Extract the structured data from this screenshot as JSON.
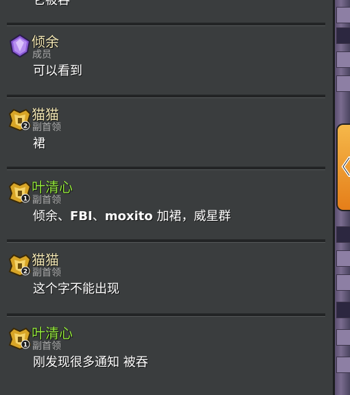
{
  "top_partial_text": "它被吞",
  "messages": [
    {
      "name": "倾余",
      "role": "成员",
      "text": "可以看到",
      "badge": "purple-league-badge-icon",
      "name_color": "#f1e6b4"
    },
    {
      "name": "猫猫",
      "role": "副首领",
      "text": "裙",
      "badge": "gold-titan-badge-2-icon",
      "badge_number": "2",
      "name_color": "#f1e6b4"
    },
    {
      "name": "叶清心",
      "role": "副首领",
      "text_parts": [
        "倾余、",
        "FBI",
        "、",
        "moxito",
        " 加裙，威星群"
      ],
      "badge": "gold-titan-badge-1-icon",
      "badge_number": "1",
      "name_color": "#94e83d"
    },
    {
      "name": "猫猫",
      "role": "副首领",
      "text": "这个字不能出现",
      "badge": "gold-titan-badge-2-icon",
      "badge_number": "2",
      "name_color": "#f1e6b4"
    },
    {
      "name": "叶清心",
      "role": "副首领",
      "text": "刚发现很多通知 被吞",
      "badge": "gold-titan-badge-1-icon",
      "badge_number": "1",
      "name_color": "#94e83d"
    }
  ],
  "collapse_tab": {
    "icon": "chevron-left-icon"
  }
}
